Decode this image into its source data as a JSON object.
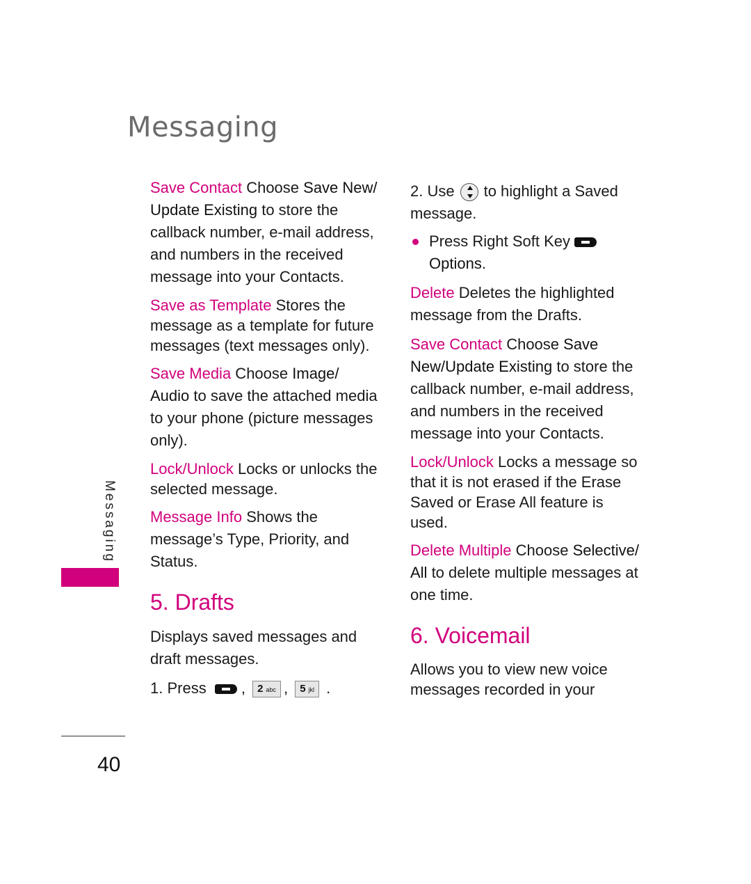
{
  "header": {
    "title": "Messaging"
  },
  "side_tab": {
    "label": "Messaging",
    "accent_color": "#d1007c"
  },
  "page_number": "40",
  "left_column": {
    "options": [
      {
        "term": "Save Contact",
        "segments": [
          " Choose ",
          "Save New/ Update Existing",
          " to store the callback number, e-mail address, and numbers in the received message into your Contacts."
        ]
      },
      {
        "term": "Save as Template",
        "segments": [
          " Stores the message as a template for future messages (text messages only)."
        ]
      },
      {
        "term": "Save Media",
        "segments": [
          " Choose ",
          "Image/ Audio",
          " to save the attached media to your phone (picture messages only)."
        ]
      },
      {
        "term": "Lock/Unlock",
        "segments": [
          " Locks or unlocks the selected message."
        ]
      },
      {
        "term": "Message Info",
        "segments": [
          " Shows the message’s Type, Priority, and Status."
        ]
      }
    ],
    "drafts": {
      "title": "5. Drafts",
      "description": "Displays saved messages and draft messages.",
      "step1_prefix": "1. Press",
      "keys": [
        {
          "icon": "left-soft-key-icon"
        },
        {
          "digit": "2",
          "letters": "abc"
        },
        {
          "digit": "5",
          "letters": "jkl"
        }
      ],
      "separator": ",",
      "terminator": "."
    }
  },
  "right_column": {
    "step2_prefix": "2. Use",
    "step2_suffix": "to highlight a Saved message.",
    "bullet_prefix": "Press Right Soft Key",
    "bullet_bold": "Options",
    "bullet_end": ".",
    "options": [
      {
        "term": "Delete",
        "segments": [
          " Deletes the highlighted message from the Drafts."
        ]
      },
      {
        "term": "Save Contact",
        "segments": [
          " Choose ",
          "Save New/Update Existing",
          " to store the callback number, e-mail address, and numbers in the received message into your Contacts."
        ]
      },
      {
        "term": "Lock/Unlock",
        "segments": [
          " Locks a message so that it is not erased if the Erase Saved or Erase All feature is used."
        ]
      },
      {
        "term": "Delete Multiple",
        "segments": [
          " Choose ",
          "Selective/ All",
          " to delete multiple messages at one time."
        ]
      }
    ],
    "voicemail": {
      "title": "6. Voicemail",
      "description": "Allows you to view new voice messages recorded in your"
    }
  }
}
